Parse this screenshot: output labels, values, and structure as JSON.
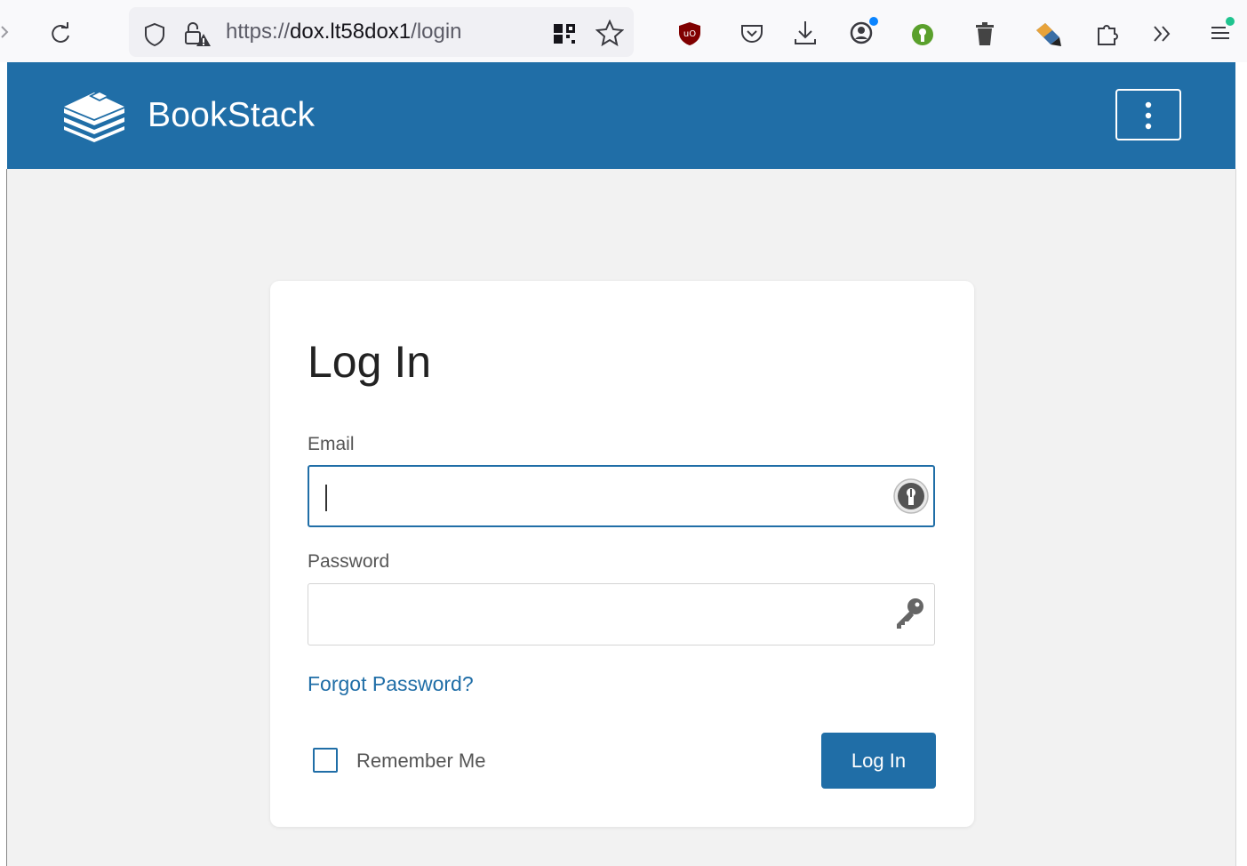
{
  "browser": {
    "url_scheme": "https://",
    "url_host": "dox.lt58dox1",
    "url_path": "/login",
    "icons": [
      "back-arrow-icon",
      "reload-icon",
      "shield-icon",
      "lock-warning-icon",
      "qr-code-icon",
      "bookmark-star-icon",
      "ublock-icon",
      "pocket-icon",
      "download-icon",
      "account-icon",
      "keepass-icon",
      "trash-icon",
      "pen-icon",
      "extensions-icon",
      "overflow-chevron-icon",
      "app-menu-icon"
    ]
  },
  "header": {
    "brand": "BookStack",
    "logo_icon": "bookstack-logo-icon",
    "menu_icon": "vertical-dots-icon",
    "color": "#206ea7"
  },
  "login": {
    "title": "Log In",
    "email_label": "Email",
    "email_value": "",
    "password_label": "Password",
    "password_value": "",
    "forgot_link": "Forgot Password?",
    "remember_label": "Remember Me",
    "remember_checked": false,
    "submit_label": "Log In"
  },
  "colors": {
    "primary": "#206ea7",
    "background": "#f2f2f2",
    "card": "#ffffff"
  }
}
